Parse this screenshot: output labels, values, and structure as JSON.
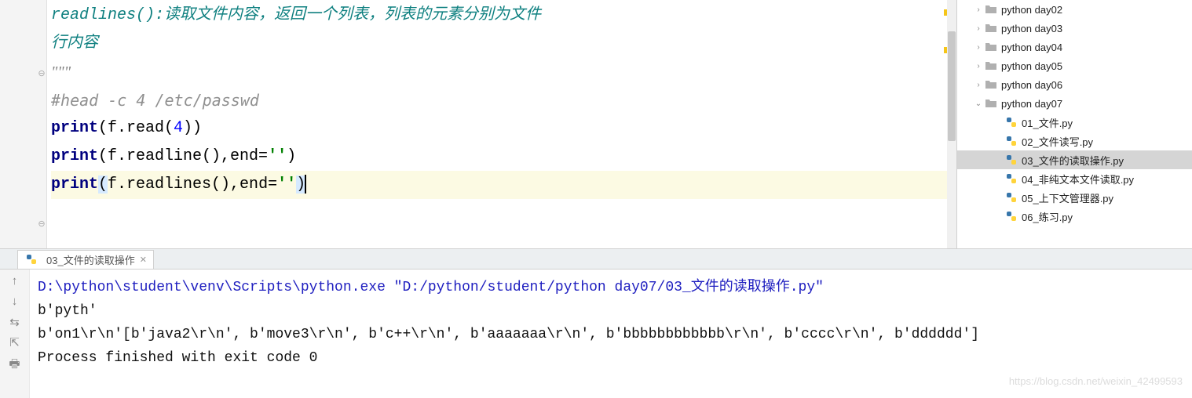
{
  "editor": {
    "lines": {
      "doc1": "readlines():读取文件内容，返回一个列表，列表的元素分别为文件",
      "doc2": "行内容",
      "doc3": "\"\"\"",
      "comment": "#head -c 4 /etc/passwd",
      "l1_print": "print",
      "l1_rest_a": "(f.read(",
      "l1_num": "4",
      "l1_rest_b": "))",
      "l2_print": "print",
      "l2_rest_a": "(f.readline(),end=",
      "l2_str": "''",
      "l2_rest_b": ")",
      "l3_print": "print",
      "l3_open": "(",
      "l3_mid": "f.readlines(),end=",
      "l3_str": "''",
      "l3_close": ")"
    }
  },
  "project": {
    "folders": [
      {
        "name": "python day02",
        "expanded": false,
        "indent": 1
      },
      {
        "name": "python day03",
        "expanded": false,
        "indent": 1
      },
      {
        "name": "python day04",
        "expanded": false,
        "indent": 1
      },
      {
        "name": "python day05",
        "expanded": false,
        "indent": 1
      },
      {
        "name": "python day06",
        "expanded": false,
        "indent": 1
      },
      {
        "name": "python day07",
        "expanded": true,
        "indent": 1
      }
    ],
    "files": [
      {
        "name": "01_文件.py",
        "selected": false
      },
      {
        "name": "02_文件读写.py",
        "selected": false
      },
      {
        "name": "03_文件的读取操作.py",
        "selected": true
      },
      {
        "name": "04_非纯文本文件读取.py",
        "selected": false
      },
      {
        "name": "05_上下文管理器.py",
        "selected": false
      },
      {
        "name": "06_练习.py",
        "selected": false
      }
    ]
  },
  "run": {
    "tab_label": "03_文件的读取操作",
    "output": {
      "cmd": "D:\\python\\student\\venv\\Scripts\\python.exe \"D:/python/student/python day07/03_文件的读取操作.py\"",
      "line2": "b'pyth'",
      "line3": "b'on1\\r\\n'[b'java2\\r\\n', b'move3\\r\\n', b'c++\\r\\n', b'aaaaaaa\\r\\n', b'bbbbbbbbbbbb\\r\\n', b'cccc\\r\\n', b'dddddd']",
      "exit": "Process finished with exit code 0"
    }
  },
  "watermark": "https://blog.csdn.net/weixin_42499593"
}
